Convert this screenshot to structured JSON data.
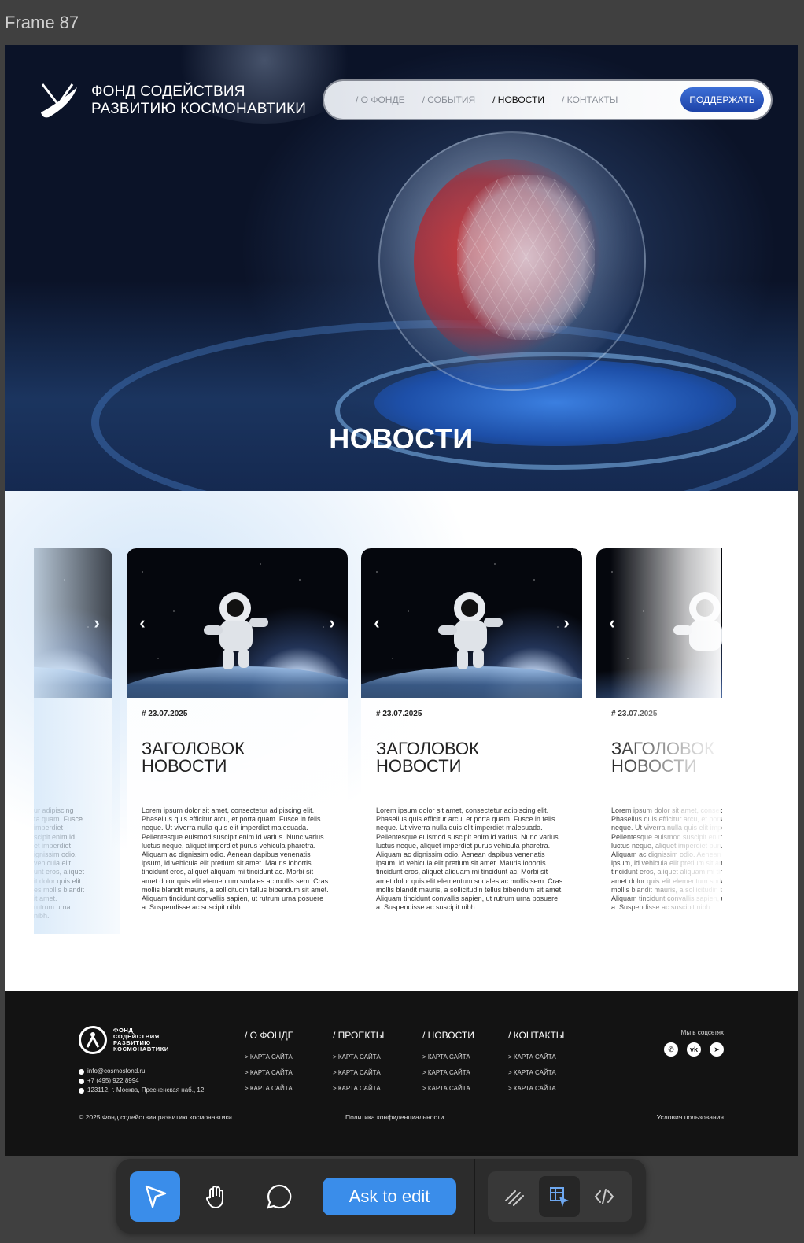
{
  "frame_label": "Frame 87",
  "header": {
    "logo_line1": "Фонд содействия",
    "logo_line2": "развитию космонавтики",
    "nav": [
      "/ О ФОНДЕ",
      "/ СОБЫТИЯ",
      "/ НОВОСТИ",
      "/ КОНТАКТЫ"
    ],
    "active_nav_index": 2,
    "support_button": "ПОДДЕРЖАТЬ"
  },
  "hero": {
    "title": "НОВОСТИ"
  },
  "news": {
    "cards": [
      {
        "date": "# 23.07.2025",
        "title": "Заголовок новости",
        "text": "Lorem ipsum dolor sit amet, consectetur adipiscing elit. Phasellus quis efficitur arcu, et porta quam. Fusce in felis neque. Ut viverra nulla quis elit imperdiet malesuada. Pellentesque euismod suscipit enim id varius. Nunc varius luctus neque, aliquet imperdiet purus vehicula pharetra. Aliquam ac dignissim odio. Aenean dapibus venenatis ipsum, id vehicula elit pretium sit amet. Mauris lobortis tincidunt eros, aliquet aliquam mi tincidunt ac. Morbi sit amet dolor quis elit elementum sodales ac mollis sem. Cras mollis blandit mauris, a sollicitudin tellus bibendum sit amet. Aliquam tincidunt convallis sapien, ut rutrum urna posuere a. Suspendisse ac suscipit nibh."
      },
      {
        "date": "# 23.07.2025",
        "title": "Заголовок новости",
        "text": "Lorem ipsum dolor sit amet, consectetur adipiscing elit. Phasellus quis efficitur arcu, et porta quam. Fusce in felis neque. Ut viverra nulla quis elit imperdiet malesuada. Pellentesque euismod suscipit enim id varius. Nunc varius luctus neque, aliquet imperdiet purus vehicula pharetra. Aliquam ac dignissim odio. Aenean dapibus venenatis ipsum, id vehicula elit pretium sit amet. Mauris lobortis tincidunt eros, aliquet aliquam mi tincidunt ac. Morbi sit amet dolor quis elit elementum sodales ac mollis sem. Cras mollis blandit mauris, a sollicitudin tellus bibendum sit amet. Aliquam tincidunt convallis sapien, ut rutrum urna posuere a. Suspendisse ac suscipit nibh."
      },
      {
        "date": "# 23.07.2025",
        "title": "Заголовок новости",
        "text": "Lorem ipsum dolor sit amet, consectetur adipiscing elit. Phasellus quis efficitur arcu, et porta quam. Fusce in felis neque. Ut viverra nulla quis elit imperdiet malesuada. Pellentesque euismod suscipit enim id varius. Nunc varius luctus neque, aliquet imperdiet purus vehicula pharetra. Aliquam ac dignissim odio. Aenean dapibus venenatis ipsum, id vehicula elit pretium sit amet. Mauris lobortis tincidunt eros, aliquet aliquam mi tincidunt ac. Morbi sit amet dolor quis elit elementum sodales ac mollis sem. Cras mollis blandit mauris, a sollicitudin tellus bibendum sit amet. Aliquam tincidunt convallis sapien, ut rutrum urna posuere a. Suspendisse ac suscipit nibh."
      }
    ],
    "left_partial_text": "ur adipiscing\nta quam. Fusce\nimperdiet\nscipit enim id\net imperdiet\nignissim odio.\nvehicula elit\nunt eros, aliquet\nit dolor quis elit\nes mollis blandit\nit amet.\nrutrum urna\nnibh.",
    "arrow_prev": "‹",
    "arrow_next": "›"
  },
  "footer": {
    "logo_line1": "Фонд",
    "logo_line2": "содействия",
    "logo_line3": "развитию",
    "logo_line4": "космонавтики",
    "email": "info@cosmosfond.ru",
    "phone": "+7 (495) 922 8994",
    "address": "123112, г. Москва, Пресненская наб., 12",
    "columns": [
      {
        "title": "/ О ФОНДЕ",
        "links": [
          "> КАРТА САЙТА",
          "> КАРТА САЙТА",
          "> КАРТА САЙТА"
        ]
      },
      {
        "title": "/ ПРОЕКТЫ",
        "links": [
          "> КАРТА САЙТА",
          "> КАРТА САЙТА",
          "> КАРТА САЙТА"
        ]
      },
      {
        "title": "/ НОВОСТИ",
        "links": [
          "> КАРТА САЙТА",
          "> КАРТА САЙТА",
          "> КАРТА САЙТА"
        ]
      },
      {
        "title": "/ КОНТАКТЫ",
        "links": [
          "> КАРТА САЙТА",
          "> КАРТА САЙТА",
          "> КАРТА САЙТА"
        ]
      }
    ],
    "social_label": "Мы в соцсетях",
    "social": [
      "whatsapp-icon",
      "vk-icon",
      "telegram-icon"
    ],
    "social_glyphs": [
      "✆",
      "vk",
      "➤"
    ],
    "copyright": "© 2025 Фонд содействия развитию космонавтики",
    "privacy": "Политика конфиденциальности",
    "terms": "Условия пользования"
  },
  "toolbar": {
    "ask_button": "Ask to edit",
    "tools": [
      "move-tool-icon",
      "hand-tool-icon",
      "comment-tool-icon"
    ],
    "modes": [
      "draw-mode-icon",
      "design-mode-icon",
      "code-mode-icon"
    ],
    "accent": "#3a8dea"
  }
}
